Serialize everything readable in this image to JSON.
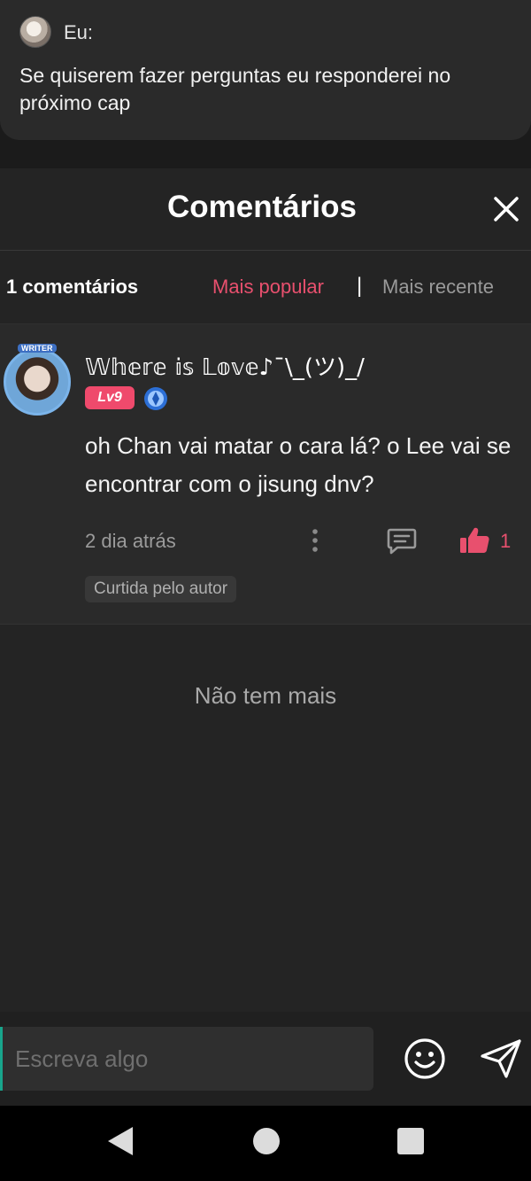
{
  "note": {
    "author": "Eu:",
    "text": "Se quiserem fazer perguntas eu responderei no próximo cap"
  },
  "comments_panel": {
    "title": "Comentários",
    "count_label": "1 comentários",
    "sort_popular": "Mais popular",
    "sort_separator": "|",
    "sort_recent": "Mais recente",
    "active_sort_color": "#e8506e",
    "comments": [
      {
        "badge": "WRITER",
        "author": "𝕎𝕙𝕖𝕣𝕖 𝕚𝕤 𝕃𝕠𝕧𝕖♪¯\\_(ツ)_/",
        "level": "Lv9",
        "text": "oh Chan vai matar o cara lá? o Lee vai se encontrar com o jisung dnv?",
        "time": "2 dia atrás",
        "likes": "1",
        "liked_by_author": "Curtida pelo autor"
      }
    ],
    "end_message": "Não tem mais"
  },
  "input": {
    "placeholder": "Escreva algo"
  },
  "icons": {
    "close": "close-icon",
    "more": "more-vertical-icon",
    "reply": "reply-icon",
    "like": "thumbs-up-icon",
    "emoji": "emoji-icon",
    "send": "send-icon",
    "rank": "rank-badge-icon"
  }
}
